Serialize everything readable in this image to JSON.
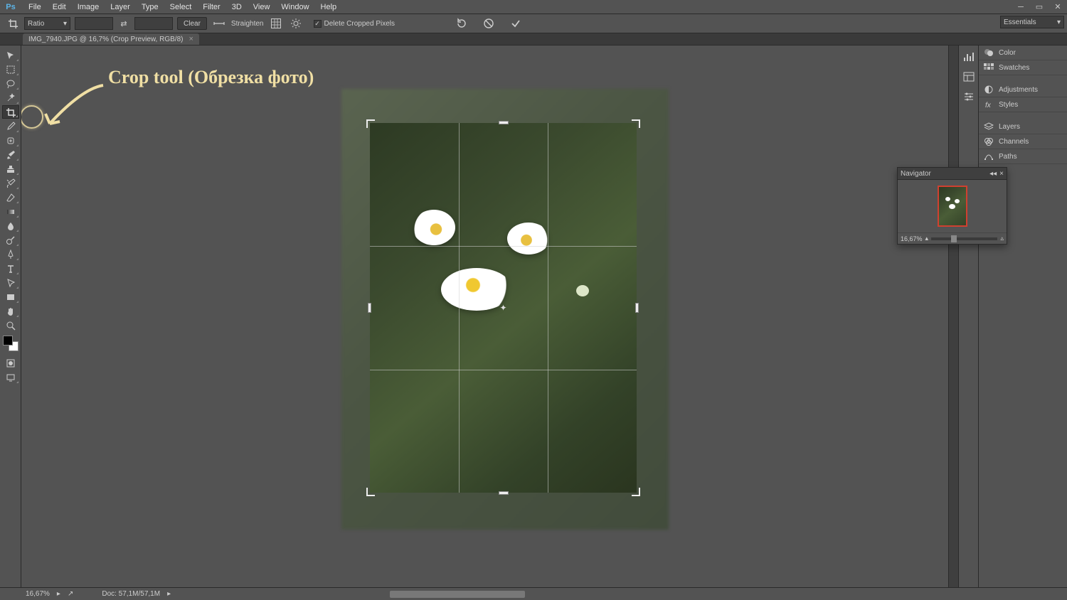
{
  "app": {
    "logo": "Ps"
  },
  "menu": [
    "File",
    "Edit",
    "Image",
    "Layer",
    "Type",
    "Select",
    "Filter",
    "3D",
    "View",
    "Window",
    "Help"
  ],
  "options": {
    "ratio_label": "Ratio",
    "clear_label": "Clear",
    "straighten_label": "Straighten",
    "delete_cropped_label": "Delete Cropped Pixels",
    "delete_cropped_checked": true
  },
  "workspace_selector": "Essentials",
  "document": {
    "tab_title": "IMG_7940.JPG @ 16,7% (Crop Preview, RGB/8)"
  },
  "annotation": {
    "text": "Crop tool (Обрезка фото)"
  },
  "right_panels": [
    "Color",
    "Swatches",
    "Adjustments",
    "Styles",
    "Layers",
    "Channels",
    "Paths"
  ],
  "navigator": {
    "title": "Navigator",
    "zoom": "16,67%"
  },
  "status": {
    "zoom": "16,67%",
    "doc_info": "Doc: 57,1M/57,1M"
  },
  "tools": [
    "move-tool",
    "rectangular-marquee-tool",
    "lasso-tool",
    "magic-wand-tool",
    "crop-tool",
    "eyedropper-tool",
    "healing-brush-tool",
    "brush-tool",
    "clone-stamp-tool",
    "history-brush-tool",
    "eraser-tool",
    "gradient-tool",
    "blur-tool",
    "dodge-tool",
    "pen-tool",
    "type-tool",
    "path-selection-tool",
    "rectangle-tool",
    "hand-tool",
    "zoom-tool"
  ]
}
